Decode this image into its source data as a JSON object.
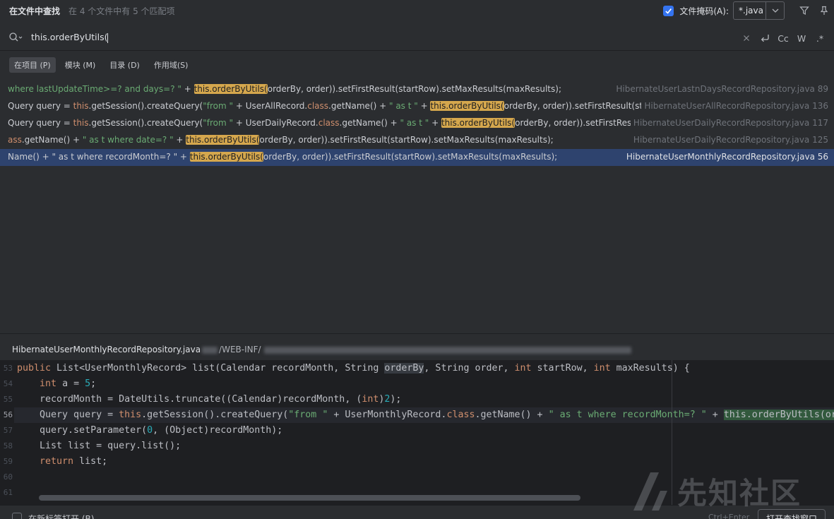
{
  "header": {
    "title": "在文件中查找",
    "subtitle": "在 4 个文件中有 5 个匹配项",
    "file_mask_label": "文件掩码(A):",
    "file_mask_value": "*.java"
  },
  "search": {
    "query": "this.orderByUtils(",
    "tools": {
      "case": "Cc",
      "word": "W",
      "regex": ".*"
    }
  },
  "scopes": [
    {
      "label": "在项目 (P)",
      "active": true
    },
    {
      "label": "模块 (M)",
      "active": false
    },
    {
      "label": "目录 (D)",
      "active": false
    },
    {
      "label": "作用域(S)",
      "active": false
    }
  ],
  "results": [
    {
      "parts": [
        {
          "t": "where lastUpdateTime>=? and days=? \"",
          "c": "str"
        },
        {
          "t": " + ",
          "c": ""
        },
        {
          "t": "this.orderByUtils(",
          "c": "hl"
        },
        {
          "t": "orderBy, order)).setFirstResult(startRow).setMaxResults(maxResults);",
          "c": ""
        }
      ],
      "file": "HibernateUserLastnDaysRecordRepository.java 89",
      "selected": false
    },
    {
      "parts": [
        {
          "t": "Query query = ",
          "c": ""
        },
        {
          "t": "this",
          "c": "kw"
        },
        {
          "t": ".getSession().createQuery(",
          "c": ""
        },
        {
          "t": "\"from \"",
          "c": "str"
        },
        {
          "t": " + UserAllRecord.",
          "c": ""
        },
        {
          "t": "class",
          "c": "kw"
        },
        {
          "t": ".getName() + ",
          "c": ""
        },
        {
          "t": "\" as t \"",
          "c": "str"
        },
        {
          "t": " + ",
          "c": ""
        },
        {
          "t": "this.orderByUtils(",
          "c": "hl"
        },
        {
          "t": "orderBy, order)).setFirstResult(startRow)",
          "c": ""
        }
      ],
      "file": "HibernateUserAllRecordRepository.java 136",
      "selected": false
    },
    {
      "parts": [
        {
          "t": "Query query = ",
          "c": ""
        },
        {
          "t": "this",
          "c": "kw"
        },
        {
          "t": ".getSession().createQuery(",
          "c": ""
        },
        {
          "t": "\"from \"",
          "c": "str"
        },
        {
          "t": " + UserDailyRecord.",
          "c": ""
        },
        {
          "t": "class",
          "c": "kw"
        },
        {
          "t": ".getName() + ",
          "c": ""
        },
        {
          "t": "\" as t \"",
          "c": "str"
        },
        {
          "t": " + ",
          "c": ""
        },
        {
          "t": "this.orderByUtils(",
          "c": "hl"
        },
        {
          "t": "orderBy, order)).setFirstResult(start",
          "c": ""
        }
      ],
      "file": "HibernateUserDailyRecordRepository.java 117",
      "selected": false
    },
    {
      "parts": [
        {
          "t": "ass",
          "c": "kw"
        },
        {
          "t": ".getName() + ",
          "c": ""
        },
        {
          "t": "\" as t where date=? \"",
          "c": "str"
        },
        {
          "t": " + ",
          "c": ""
        },
        {
          "t": "this.orderByUtils(",
          "c": "hl"
        },
        {
          "t": "orderBy, order)).setFirstResult(startRow).setMaxResults(maxResults);",
          "c": ""
        }
      ],
      "file": "HibernateUserDailyRecordRepository.java 125",
      "selected": false
    },
    {
      "parts": [
        {
          "t": "Name() + \" as t where recordMonth=? \" + ",
          "c": ""
        },
        {
          "t": "this.orderByUtils(",
          "c": "hl"
        },
        {
          "t": "orderBy, order)).setFirstResult(startRow).setMaxResults(maxResults);",
          "c": ""
        }
      ],
      "file": "HibernateUserMonthlyRecordRepository.java 56",
      "selected": true
    }
  ],
  "preview": {
    "file_name": "HibernateUserMonthlyRecordRepository.java",
    "dir_prefix": "/WEB-INF/"
  },
  "editor": {
    "lines": [
      {
        "n": "53",
        "parts": [
          {
            "t": "public ",
            "c": "kw"
          },
          {
            "t": "List<UserMonthlyRecord> list(Calendar recordMonth, String ",
            "c": ""
          },
          {
            "t": "orderBy",
            "c": "ed-sel"
          },
          {
            "t": ", String order, ",
            "c": ""
          },
          {
            "t": "int ",
            "c": "kw"
          },
          {
            "t": "startRow, ",
            "c": ""
          },
          {
            "t": "int ",
            "c": "kw"
          },
          {
            "t": "maxResults) {",
            "c": ""
          }
        ]
      },
      {
        "n": "54",
        "parts": [
          {
            "t": "    ",
            "c": ""
          },
          {
            "t": "int ",
            "c": "kw"
          },
          {
            "t": "a = ",
            "c": ""
          },
          {
            "t": "5",
            "c": "num"
          },
          {
            "t": ";",
            "c": ""
          }
        ]
      },
      {
        "n": "55",
        "parts": [
          {
            "t": "    recordMonth = DateUtils.truncate((Calendar)recordMonth, (",
            "c": ""
          },
          {
            "t": "int",
            "c": "kw"
          },
          {
            "t": ")",
            "c": ""
          },
          {
            "t": "2",
            "c": "num"
          },
          {
            "t": ");",
            "c": ""
          }
        ]
      },
      {
        "n": "56",
        "current": true,
        "parts": [
          {
            "t": "    Query query = ",
            "c": ""
          },
          {
            "t": "this",
            "c": "kw"
          },
          {
            "t": ".getSession().createQuery(",
            "c": ""
          },
          {
            "t": "\"from \"",
            "c": "str"
          },
          {
            "t": " + UserMonthlyRecord.",
            "c": ""
          },
          {
            "t": "class",
            "c": "kw"
          },
          {
            "t": ".getName() + ",
            "c": ""
          },
          {
            "t": "\" as t where recordMonth=? \"",
            "c": "str"
          },
          {
            "t": " + ",
            "c": ""
          },
          {
            "t": "this.orderByUtils(or",
            "c": "ed-hl"
          }
        ]
      },
      {
        "n": "57",
        "parts": [
          {
            "t": "    query.setParameter(",
            "c": ""
          },
          {
            "t": "0",
            "c": "num"
          },
          {
            "t": ", (Object)recordMonth);",
            "c": ""
          }
        ]
      },
      {
        "n": "58",
        "parts": [
          {
            "t": "    List list = query.list();",
            "c": ""
          }
        ]
      },
      {
        "n": "59",
        "parts": [
          {
            "t": "    ",
            "c": ""
          },
          {
            "t": "return ",
            "c": "kw"
          },
          {
            "t": "list;",
            "c": ""
          }
        ]
      },
      {
        "n": "60",
        "parts": []
      },
      {
        "n": "61",
        "parts": []
      }
    ]
  },
  "bottom": {
    "open_new_tab_label": "在新标签打开 (B)",
    "hint": "Ctrl+Enter",
    "open_window_button": "打开查找窗口"
  },
  "watermark": {
    "text": "先知社区"
  }
}
